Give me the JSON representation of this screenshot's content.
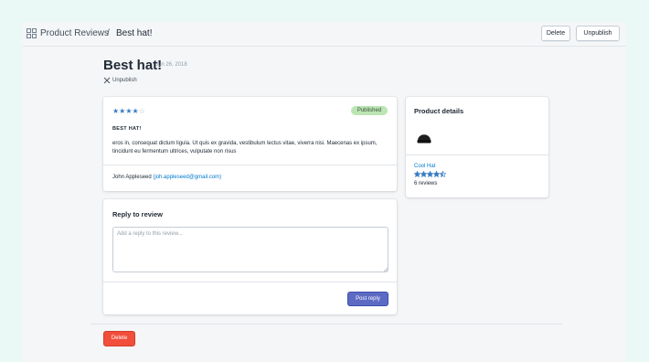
{
  "header": {
    "app_name": "Product Reviews",
    "separator": "/",
    "page_name": "Best hat!",
    "delete_label": "Delete",
    "unpublish_label": "Unpublish"
  },
  "title": {
    "text": "Best hat!",
    "date": "Jun 26, 2018",
    "unpublish_action": "Unpublish"
  },
  "review": {
    "rating": 4,
    "max_rating": 5,
    "status": "Published",
    "heading": "BEST HAT!",
    "body": "eros in, consequat dictum ligula. Ut quis ex gravida, vestibulum lectus vitae, viverra nisi. Maecenas ex ipsum, tincidunt eu fermentum ultrices, vulputate non risus",
    "author": "John Appleseed",
    "email": "(joh.appleseed@gmail.com)"
  },
  "reply": {
    "heading": "Reply to review",
    "placeholder": "Add a reply to this review...",
    "value": "",
    "submit_label": "Post reply"
  },
  "product": {
    "heading": "Product details",
    "name": "Cool Hat",
    "average_rating": 4.5,
    "reviews_count": "6 reviews"
  },
  "footer": {
    "delete_label": "Delete"
  },
  "colors": {
    "background": "#eaf8f6",
    "accent": "#5c6ac4",
    "link": "#007ace",
    "star": "#3a7dc4",
    "published_badge": "#bbe5b3",
    "danger": "#f14f3b"
  }
}
